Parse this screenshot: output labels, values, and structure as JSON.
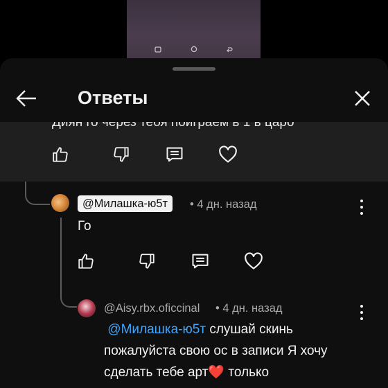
{
  "header": {
    "title": "Ответы"
  },
  "parent_comment": {
    "cut_text": "Диян го через тебя поиграем в 1 в царо"
  },
  "reply_1": {
    "mention": "@Милашка-ю5т",
    "time": "• 4 дн. назад",
    "text": "Го"
  },
  "reply_2": {
    "author": "@Aisy.rbx.oficcinal",
    "time": "• 4 дн. назад",
    "mention": "@Милашка-ю5т",
    "text_part1": " слушай скинь пожалуйста свою ос в записи Я хочу сделать тебе арт",
    "emoji": "❤️",
    "text_part2": " только"
  },
  "icons": [
    "back-arrow",
    "close",
    "like",
    "dislike",
    "reply",
    "heart",
    "more-vert"
  ],
  "colors": {
    "sheet_bg": "#0f0f0f",
    "highlight_bg": "#1f1f1f",
    "mention_link": "#3ea6ff",
    "meta": "#aaaaaa"
  }
}
